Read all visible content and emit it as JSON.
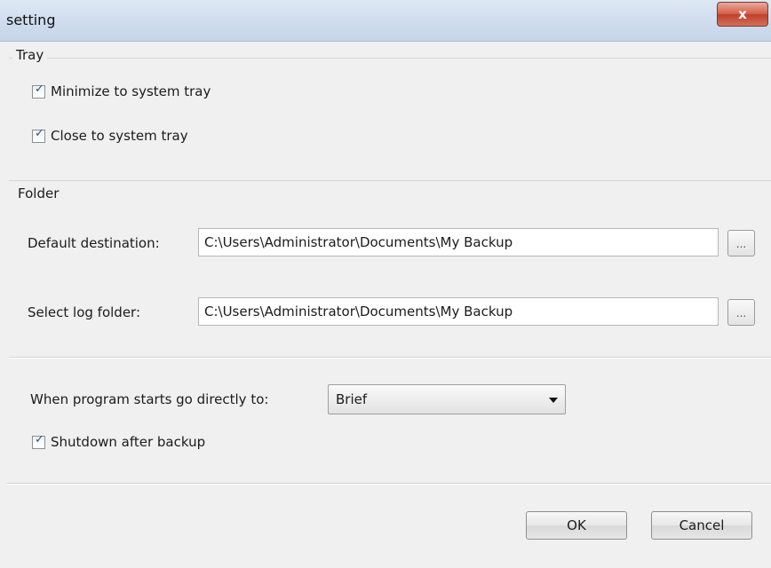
{
  "window": {
    "title": "setting",
    "close_label": "x"
  },
  "tray": {
    "group_label": "Tray",
    "minimize": {
      "label": "Minimize to system tray",
      "checked": true
    },
    "close": {
      "label": "Close to system tray",
      "checked": true
    }
  },
  "folder": {
    "group_label": "Folder",
    "default_destination": {
      "label": "Default destination:",
      "value": "C:\\Users\\Administrator\\Documents\\My Backup",
      "browse_label": "..."
    },
    "log_folder": {
      "label": "Select log folder:",
      "value": "C:\\Users\\Administrator\\Documents\\My Backup",
      "browse_label": "..."
    }
  },
  "startup": {
    "label": "When program starts go directly to:",
    "selected": "Brief",
    "shutdown": {
      "label": "Shutdown after backup",
      "checked": true
    }
  },
  "buttons": {
    "ok": "OK",
    "cancel": "Cancel"
  }
}
